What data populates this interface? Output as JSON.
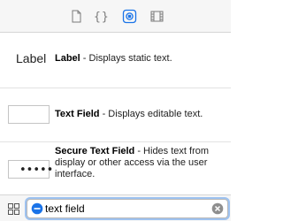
{
  "toolbar": {
    "tabs": [
      {
        "icon": "file-icon",
        "selected": false
      },
      {
        "icon": "code-braces-icon",
        "label": "{}",
        "selected": false
      },
      {
        "icon": "object-library-icon",
        "selected": true
      },
      {
        "icon": "media-library-icon",
        "selected": false
      }
    ],
    "accent_color": "#1a73e8"
  },
  "library": {
    "items": [
      {
        "preview_text": "Label",
        "name": "Label",
        "description": " - Displays static text."
      },
      {
        "preview_text": "",
        "name": "Text Field",
        "description": " - Displays editable text."
      },
      {
        "preview_text": "•••••",
        "name": "Secure Text Field",
        "description": " - Hides text from display or other access via the user interface."
      }
    ]
  },
  "footer": {
    "search_value": "text field",
    "grid_icon": "grid-view-icon",
    "clear_icon": "clear-search-icon"
  }
}
